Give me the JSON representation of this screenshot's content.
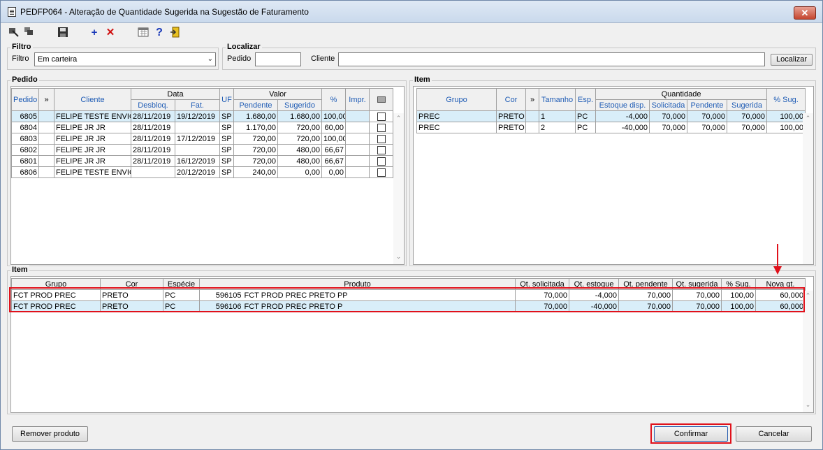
{
  "window": {
    "title": "PEDFP064 - Alteração de Quantidade Sugerida na Sugestão de Faturamento",
    "close_label": "✕"
  },
  "toolbar": {
    "icons": [
      "select-all-icon",
      "multi-select-icon",
      "save-icon",
      "add-icon",
      "delete-icon",
      "calendar-icon",
      "help-icon",
      "exit-icon"
    ]
  },
  "filtro": {
    "group_label": "Filtro",
    "label": "Filtro",
    "value": "Em carteira"
  },
  "localizar": {
    "group_label": "Localizar",
    "pedido_label": "Pedido",
    "pedido_value": "",
    "cliente_label": "Cliente",
    "cliente_value": "",
    "button_label": "Localizar"
  },
  "pedido": {
    "group_label": "Pedido",
    "headers": {
      "pedido": "Pedido",
      "more": "»",
      "cliente": "Cliente",
      "data": "Data",
      "desbloq": "Desbloq.",
      "fat": "Fat.",
      "uf": "UF",
      "valor": "Valor",
      "pendente": "Pendente",
      "sugerido": "Sugerido",
      "pct": "%",
      "impr": "Impr."
    },
    "rows": [
      {
        "pedido": "6805",
        "cliente": "FELIPE TESTE ENVIO C",
        "desbloq": "28/11/2019",
        "fat": "19/12/2019",
        "uf": "SP",
        "pendente": "1.680,00",
        "sugerido": "1.680,00",
        "pct": "100,00",
        "impr": ""
      },
      {
        "pedido": "6804",
        "cliente": "FELIPE JR JR",
        "desbloq": "28/11/2019",
        "fat": "",
        "uf": "SP",
        "pendente": "1.170,00",
        "sugerido": "720,00",
        "pct": "60,00",
        "impr": ""
      },
      {
        "pedido": "6803",
        "cliente": "FELIPE JR JR",
        "desbloq": "28/11/2019",
        "fat": "17/12/2019",
        "uf": "SP",
        "pendente": "720,00",
        "sugerido": "720,00",
        "pct": "100,00",
        "impr": ""
      },
      {
        "pedido": "6802",
        "cliente": "FELIPE JR JR",
        "desbloq": "28/11/2019",
        "fat": "",
        "uf": "SP",
        "pendente": "720,00",
        "sugerido": "480,00",
        "pct": "66,67",
        "impr": ""
      },
      {
        "pedido": "6801",
        "cliente": "FELIPE JR JR",
        "desbloq": "28/11/2019",
        "fat": "16/12/2019",
        "uf": "SP",
        "pendente": "720,00",
        "sugerido": "480,00",
        "pct": "66,67",
        "impr": ""
      },
      {
        "pedido": "6806",
        "cliente": "FELIPE TESTE ENVIO C",
        "desbloq": "",
        "fat": "20/12/2019",
        "uf": "SP",
        "pendente": "240,00",
        "sugerido": "0,00",
        "pct": "0,00",
        "impr": ""
      }
    ]
  },
  "item_top": {
    "group_label": "Item",
    "headers": {
      "grupo": "Grupo",
      "cor": "Cor",
      "more": "»",
      "tamanho": "Tamanho",
      "esp": "Esp.",
      "quantidade": "Quantidade",
      "estoque": "Estoque disp.",
      "solicitada": "Solicitada",
      "pendente": "Pendente",
      "sugerida": "Sugerida",
      "pct_sug": "% Sug."
    },
    "rows": [
      {
        "grupo": "PREC",
        "cor": "PRETO",
        "tamanho": "1",
        "esp": "PC",
        "estoque": "-4,000",
        "solicitada": "70,000",
        "pendente": "70,000",
        "sugerida": "70,000",
        "pct_sug": "100,00"
      },
      {
        "grupo": "PREC",
        "cor": "PRETO",
        "tamanho": "2",
        "esp": "PC",
        "estoque": "-40,000",
        "solicitada": "70,000",
        "pendente": "70,000",
        "sugerida": "70,000",
        "pct_sug": "100,00"
      }
    ]
  },
  "item_bottom": {
    "group_label": "Item",
    "headers": {
      "grupo": "Grupo",
      "cor": "Cor",
      "especie": "Espécie",
      "produto": "Produto",
      "qt_solicitada": "Qt. solicitada",
      "qt_estoque": "Qt. estoque",
      "qt_pendente": "Qt. pendente",
      "qt_sugerida": "Qt. sugerida",
      "pct_sug": "% Sug.",
      "nova_qt": "Nova qt."
    },
    "rows": [
      {
        "grupo": "FCT PROD PREC",
        "cor": "PRETO",
        "especie": "PC",
        "codigo": "596105",
        "produto": "FCT PROD PREC PRETO PP",
        "qt_solicitada": "70,000",
        "qt_estoque": "-4,000",
        "qt_pendente": "70,000",
        "qt_sugerida": "70,000",
        "pct_sug": "100,00",
        "nova_qt": "60,000"
      },
      {
        "grupo": "FCT PROD PREC",
        "cor": "PRETO",
        "especie": "PC",
        "codigo": "596106",
        "produto": "FCT PROD PREC PRETO P",
        "qt_solicitada": "70,000",
        "qt_estoque": "-40,000",
        "qt_pendente": "70,000",
        "qt_sugerida": "70,000",
        "pct_sug": "100,00",
        "nova_qt": "60,000"
      }
    ]
  },
  "footer": {
    "remover_label": "Remover produto",
    "confirmar_label": "Confirmar",
    "cancelar_label": "Cancelar"
  },
  "colors": {
    "highlight_red": "#e0111b",
    "header_blue_text": "#1f5cb5",
    "selected_row": "#d9eef9"
  }
}
